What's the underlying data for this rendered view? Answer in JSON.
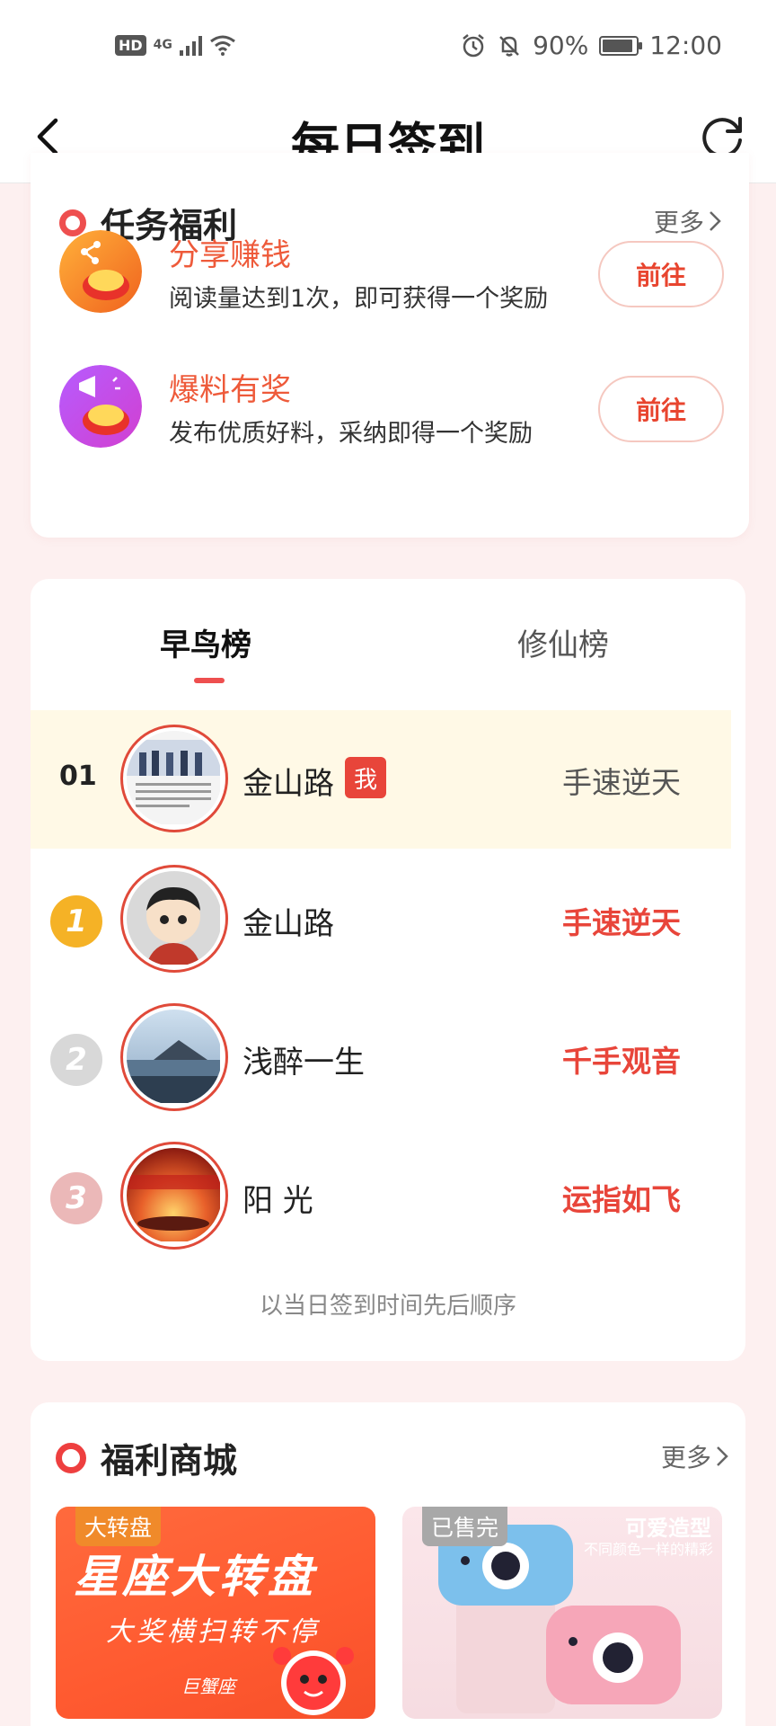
{
  "status_bar": {
    "hd": "HD",
    "network": "4G",
    "battery_percent": "90%",
    "battery_level": 0.9,
    "time": "12:00"
  },
  "header": {
    "title": "每日签到"
  },
  "tasks": {
    "title": "任务福利",
    "more": "更多",
    "items": [
      {
        "title": "分享赚钱",
        "desc": "阅读量达到1次，即可获得一个奖励",
        "button": "前往"
      },
      {
        "title": "爆料有奖",
        "desc": "发布优质好料，采纳即得一个奖励",
        "button": "前往"
      }
    ]
  },
  "ranking": {
    "tabs": [
      "早鸟榜",
      "修仙榜"
    ],
    "me": {
      "rank": "01",
      "name": "金山路",
      "badge": "我",
      "tag": "手速逆天"
    },
    "rows": [
      {
        "medal": "1",
        "name": "金山路",
        "tag": "手速逆天"
      },
      {
        "medal": "2",
        "name": "浅醉一生",
        "tag": "千手观音"
      },
      {
        "medal": "3",
        "name": "阳 光",
        "tag": "运指如飞"
      }
    ],
    "note": "以当日签到时间先后顺序"
  },
  "mall": {
    "title": "福利商城",
    "more": "更多",
    "items": [
      {
        "badge": "大转盘",
        "headline": "星座大转盘",
        "subline": "大奖横扫转不停",
        "brand": "巨蟹座"
      },
      {
        "badge": "已售完",
        "headline": "可爱造型",
        "subline": "不同颜色一样的精彩"
      }
    ]
  },
  "colors": {
    "accent": "#ee4f4f",
    "task_title": "#ee5a3a",
    "me_row_bg": "#fff9e6",
    "page_bg": "#fdf0f0"
  }
}
